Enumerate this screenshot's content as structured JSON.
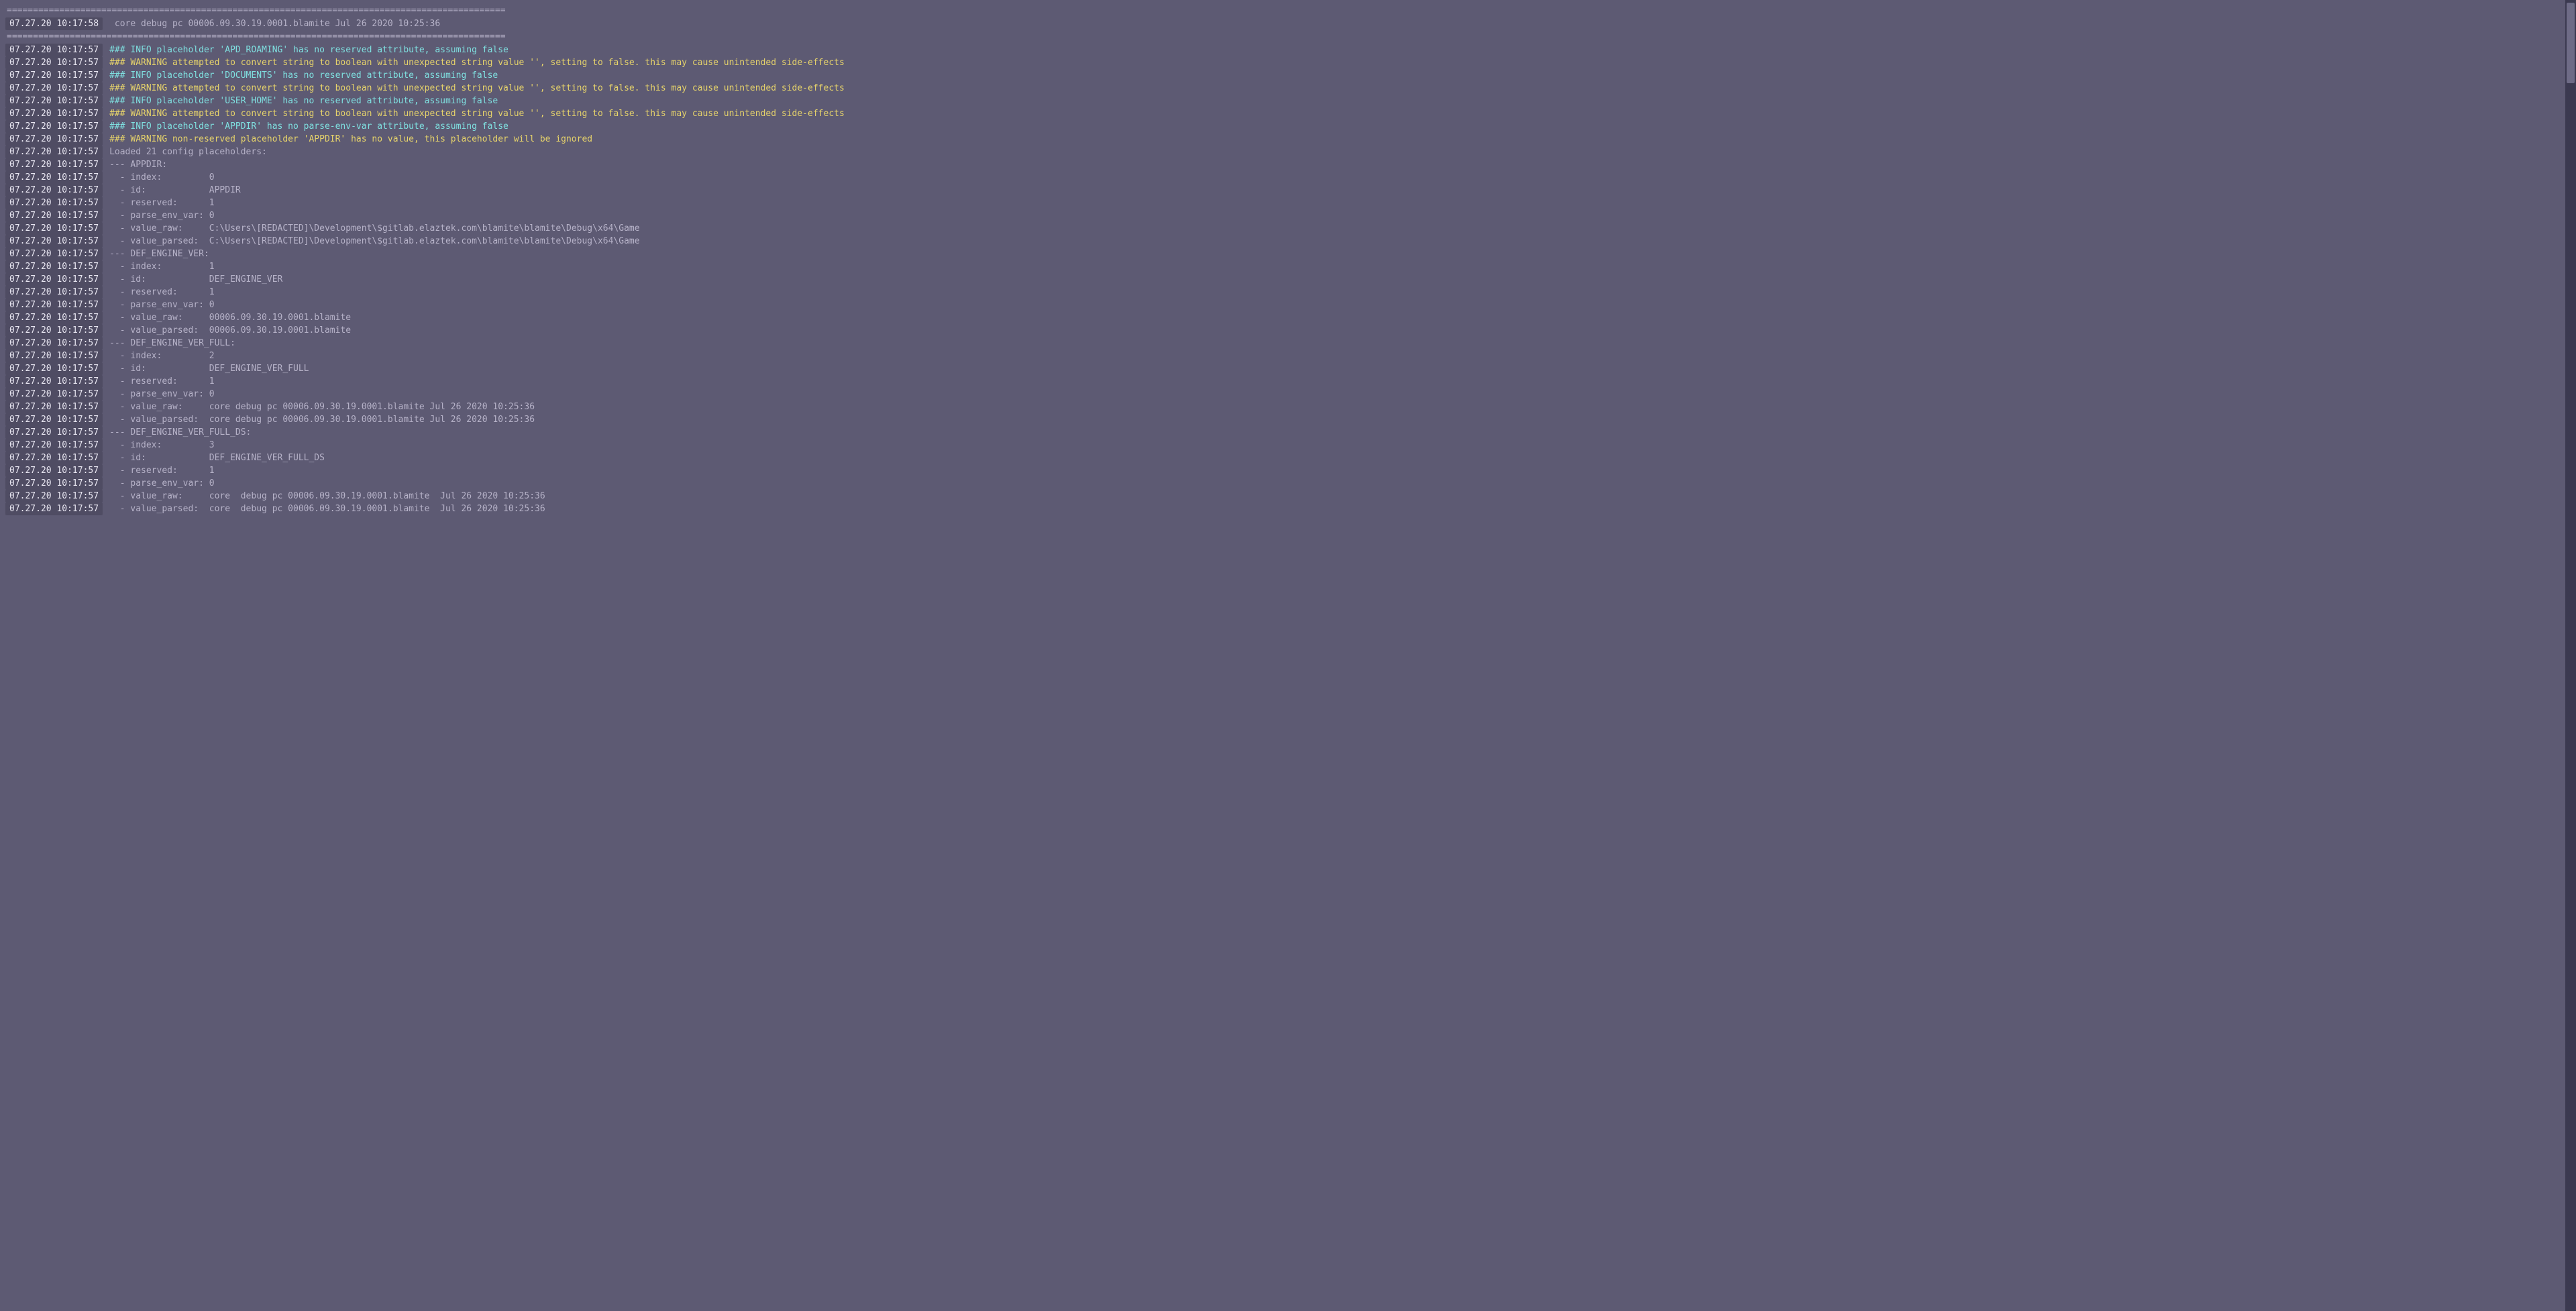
{
  "rule": "===============================================================================================",
  "lines": [
    {
      "type": "rule"
    },
    {
      "ts": "07.27.20 10:17:58",
      "style": "dim",
      "msg": " core debug pc 00006.09.30.19.0001.blamite Jul 26 2020 10:25:36"
    },
    {
      "type": "rule"
    },
    {
      "ts": "07.27.20 10:17:57",
      "style": "info",
      "msg": "### INFO placeholder 'APD_ROAMING' has no reserved attribute, assuming false"
    },
    {
      "ts": "07.27.20 10:17:57",
      "style": "warn",
      "msg": "### WARNING attempted to convert string to boolean with unexpected string value '', setting to false. this may cause unintended side-effects"
    },
    {
      "ts": "07.27.20 10:17:57",
      "style": "info",
      "msg": "### INFO placeholder 'DOCUMENTS' has no reserved attribute, assuming false"
    },
    {
      "ts": "07.27.20 10:17:57",
      "style": "warn",
      "msg": "### WARNING attempted to convert string to boolean with unexpected string value '', setting to false. this may cause unintended side-effects"
    },
    {
      "ts": "07.27.20 10:17:57",
      "style": "info",
      "msg": "### INFO placeholder 'USER_HOME' has no reserved attribute, assuming false"
    },
    {
      "ts": "07.27.20 10:17:57",
      "style": "warn",
      "msg": "### WARNING attempted to convert string to boolean with unexpected string value '', setting to false. this may cause unintended side-effects"
    },
    {
      "ts": "07.27.20 10:17:57",
      "style": "info",
      "msg": "### INFO placeholder 'APPDIR' has no parse-env-var attribute, assuming false"
    },
    {
      "ts": "07.27.20 10:17:57",
      "style": "warn",
      "msg": "### WARNING non-reserved placeholder 'APPDIR' has no value, this placeholder will be ignored"
    },
    {
      "ts": "07.27.20 10:17:57",
      "style": "dim",
      "msg": "Loaded 21 config placeholders:"
    },
    {
      "ts": "07.27.20 10:17:57",
      "style": "dim",
      "msg": "--- APPDIR:"
    },
    {
      "ts": "07.27.20 10:17:57",
      "style": "dim",
      "msg": "  - index:         0"
    },
    {
      "ts": "07.27.20 10:17:57",
      "style": "dim",
      "msg": "  - id:            APPDIR"
    },
    {
      "ts": "07.27.20 10:17:57",
      "style": "dim",
      "msg": "  - reserved:      1"
    },
    {
      "ts": "07.27.20 10:17:57",
      "style": "dim",
      "msg": "  - parse_env_var: 0"
    },
    {
      "ts": "07.27.20 10:17:57",
      "style": "dim",
      "msg": "  - value_raw:     C:\\Users\\[REDACTED]\\Development\\$gitlab.elaztek.com\\blamite\\blamite\\Debug\\x64\\Game"
    },
    {
      "ts": "07.27.20 10:17:57",
      "style": "dim",
      "msg": "  - value_parsed:  C:\\Users\\[REDACTED]\\Development\\$gitlab.elaztek.com\\blamite\\blamite\\Debug\\x64\\Game"
    },
    {
      "ts": "07.27.20 10:17:57",
      "style": "dim",
      "msg": "--- DEF_ENGINE_VER:"
    },
    {
      "ts": "07.27.20 10:17:57",
      "style": "dim",
      "msg": "  - index:         1"
    },
    {
      "ts": "07.27.20 10:17:57",
      "style": "dim",
      "msg": "  - id:            DEF_ENGINE_VER"
    },
    {
      "ts": "07.27.20 10:17:57",
      "style": "dim",
      "msg": "  - reserved:      1"
    },
    {
      "ts": "07.27.20 10:17:57",
      "style": "dim",
      "msg": "  - parse_env_var: 0"
    },
    {
      "ts": "07.27.20 10:17:57",
      "style": "dim",
      "msg": "  - value_raw:     00006.09.30.19.0001.blamite"
    },
    {
      "ts": "07.27.20 10:17:57",
      "style": "dim",
      "msg": "  - value_parsed:  00006.09.30.19.0001.blamite"
    },
    {
      "ts": "07.27.20 10:17:57",
      "style": "dim",
      "msg": "--- DEF_ENGINE_VER_FULL:"
    },
    {
      "ts": "07.27.20 10:17:57",
      "style": "dim",
      "msg": "  - index:         2"
    },
    {
      "ts": "07.27.20 10:17:57",
      "style": "dim",
      "msg": "  - id:            DEF_ENGINE_VER_FULL"
    },
    {
      "ts": "07.27.20 10:17:57",
      "style": "dim",
      "msg": "  - reserved:      1"
    },
    {
      "ts": "07.27.20 10:17:57",
      "style": "dim",
      "msg": "  - parse_env_var: 0"
    },
    {
      "ts": "07.27.20 10:17:57",
      "style": "dim",
      "msg": "  - value_raw:     core debug pc 00006.09.30.19.0001.blamite Jul 26 2020 10:25:36"
    },
    {
      "ts": "07.27.20 10:17:57",
      "style": "dim",
      "msg": "  - value_parsed:  core debug pc 00006.09.30.19.0001.blamite Jul 26 2020 10:25:36"
    },
    {
      "ts": "07.27.20 10:17:57",
      "style": "dim",
      "msg": "--- DEF_ENGINE_VER_FULL_DS:"
    },
    {
      "ts": "07.27.20 10:17:57",
      "style": "dim",
      "msg": "  - index:         3"
    },
    {
      "ts": "07.27.20 10:17:57",
      "style": "dim",
      "msg": "  - id:            DEF_ENGINE_VER_FULL_DS"
    },
    {
      "ts": "07.27.20 10:17:57",
      "style": "dim",
      "msg": "  - reserved:      1"
    },
    {
      "ts": "07.27.20 10:17:57",
      "style": "dim",
      "msg": "  - parse_env_var: 0"
    },
    {
      "ts": "07.27.20 10:17:57",
      "style": "dim",
      "msg": "  - value_raw:     core  debug pc 00006.09.30.19.0001.blamite  Jul 26 2020 10:25:36"
    },
    {
      "ts": "07.27.20 10:17:57",
      "style": "dim",
      "msg": "  - value_parsed:  core  debug pc 00006.09.30.19.0001.blamite  Jul 26 2020 10:25:36"
    }
  ]
}
